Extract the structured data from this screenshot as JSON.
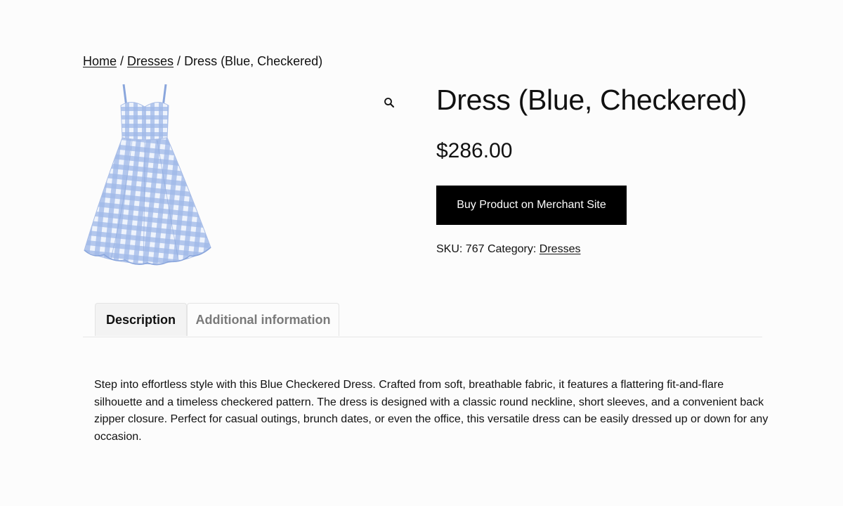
{
  "breadcrumb": {
    "home": "Home",
    "sep1": " / ",
    "category": "Dresses",
    "sep2": " / ",
    "current": "Dress (Blue, Checkered)"
  },
  "gallery": {
    "zoom_icon": "magnifier-icon",
    "image_alt": "Blue checkered sleeveless dress"
  },
  "product": {
    "title": "Dress (Blue, Checkered)",
    "price": "$286.00",
    "buy_label": "Buy Product on Merchant Site",
    "sku_label": "SKU:",
    "sku_value": "767",
    "category_label": "Category:",
    "category_value": "Dresses"
  },
  "tabs": [
    {
      "label": "Description",
      "active": true
    },
    {
      "label": "Additional information",
      "active": false
    }
  ],
  "description": {
    "text": "Step into effortless style with this Blue Checkered Dress. Crafted from soft, breathable fabric, it features a flattering fit-and-flare silhouette and a timeless checkered pattern. The dress is designed with a classic round neckline, short sleeves, and a convenient back zipper closure. Perfect for casual outings, brunch dates, or even the office, this versatile dress can be easily dressed up or down for any occasion."
  },
  "colors": {
    "button_bg": "#000000",
    "button_text": "#ffffff",
    "dress_light": "#c9d8f2",
    "dress_dark": "#7d9ee0"
  }
}
